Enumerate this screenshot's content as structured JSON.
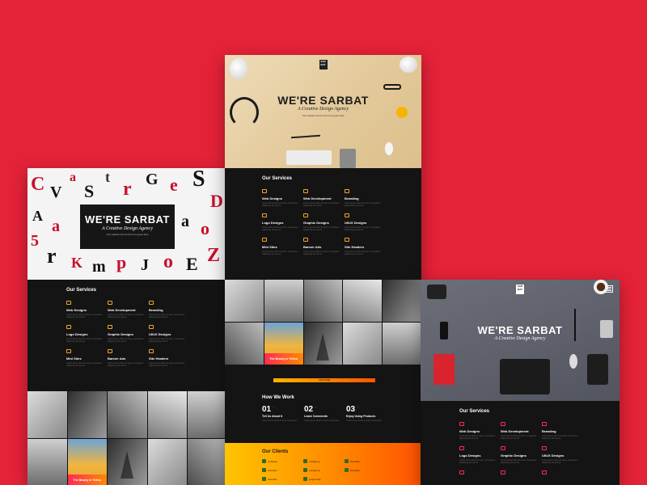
{
  "brand": {
    "logo_text": "SAR BAT",
    "title": "WE'RE SARBAT",
    "tagline": "A Creative Design Agency",
    "small_caption": "Your caption line for the hero goes here"
  },
  "services": {
    "title": "Our Services",
    "items": [
      {
        "icon": "folder-icon",
        "name": "Web Designs",
        "desc": "Lorem ipsum dolor sit amet, consectetur adipiscing elit sed do"
      },
      {
        "icon": "code-icon",
        "name": "Web Development",
        "desc": "Lorem ipsum dolor sit amet, consectetur adipiscing elit sed do"
      },
      {
        "icon": "pen-icon",
        "name": "Branding",
        "desc": "Lorem ipsum dolor sit amet, consectetur adipiscing elit sed do"
      },
      {
        "icon": "heart-icon",
        "name": "Logo Designs",
        "desc": "Lorem ipsum dolor sit amet, consectetur adipiscing elit sed do"
      },
      {
        "icon": "headphones-icon",
        "name": "Graphic Designs",
        "desc": "Lorem ipsum dolor sit amet, consectetur adipiscing elit sed do"
      },
      {
        "icon": "monitor-icon",
        "name": "UI/UX Designs",
        "desc": "Lorem ipsum dolor sit amet, consectetur adipiscing elit sed do"
      },
      {
        "icon": "browser-icon",
        "name": "Mini Sites",
        "desc": "Lorem ipsum dolor sit amet, consectetur adipiscing elit sed do"
      },
      {
        "icon": "banner-icon",
        "name": "Banner Ads",
        "desc": "Lorem ipsum dolor sit amet, consectetur adipiscing elit sed do"
      },
      {
        "icon": "cup-icon",
        "name": "Site Headers",
        "desc": "Lorem ipsum dolor sit amet, consectetur adipiscing elit sed do"
      }
    ]
  },
  "gallery": {
    "highlight_caption": "The Beauty in Yellow"
  },
  "cta": {
    "label": "VIEW MORE"
  },
  "how_we_work": {
    "title": "How We Work",
    "steps": [
      {
        "num": "01",
        "title": "Tell Us About It",
        "desc": "Lorem ipsum dolor sit amet consectetur"
      },
      {
        "num": "02",
        "title": "Leave Comments",
        "desc": "Lorem ipsum dolor sit amet consectetur"
      },
      {
        "num": "03",
        "title": "Enjoy Using Products",
        "desc": "Lorem ipsum dolor sit amet consectetur"
      }
    ]
  },
  "clients": {
    "title": "Our Clients",
    "items": [
      "webteam",
      "craftgroup",
      "brandbox",
      "artstudio",
      "craftgroup",
      "brandbox",
      "artstudio",
      "projectmax"
    ]
  },
  "colors": {
    "page_bg": "#e42238",
    "dark_bg": "#141414",
    "accent_orange": "#f5a623",
    "accent_pink": "#ff2a55"
  }
}
